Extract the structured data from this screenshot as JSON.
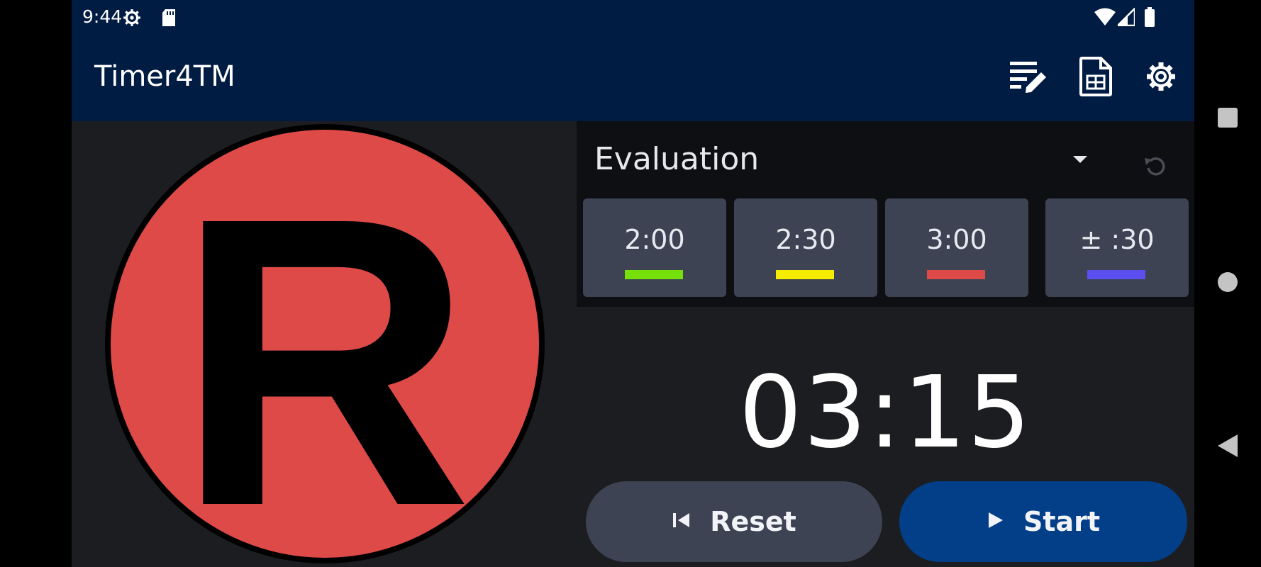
{
  "status_bar": {
    "time": "9:44",
    "icons": [
      "settings-notification-icon",
      "sd-card-icon",
      "wifi-icon",
      "cell-signal-icon",
      "battery-icon"
    ]
  },
  "app_bar": {
    "title": "Timer4TM",
    "actions": [
      "edit-notes-icon",
      "spreadsheet-icon",
      "settings-gear-icon"
    ]
  },
  "status_light": {
    "letter": "R",
    "color": "#dd4a48"
  },
  "speech": {
    "selected_type": "Evaluation",
    "time_cards": [
      {
        "label": "2:00",
        "color": "#76e00a"
      },
      {
        "label": "2:30",
        "color": "#f5ec00"
      },
      {
        "label": "3:00",
        "color": "#dd4a48"
      },
      {
        "label": "± :30",
        "color": "#5b4ff0"
      }
    ]
  },
  "timer": {
    "display": "03:15"
  },
  "controls": {
    "reset_label": "Reset",
    "start_label": "Start"
  },
  "colors": {
    "app_bar": "#011c43",
    "start_button": "#023f88",
    "card": "#3d4352"
  }
}
